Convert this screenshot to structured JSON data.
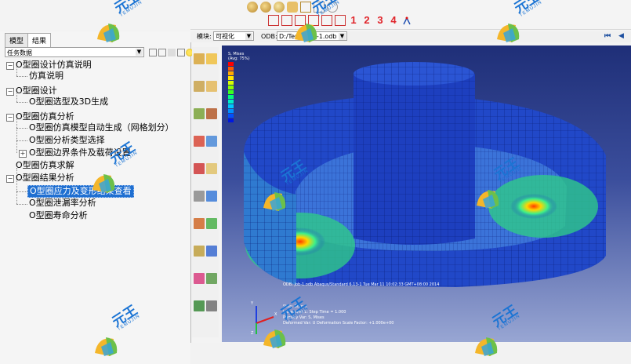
{
  "left_panel": {
    "tabs": [
      {
        "label": "模型",
        "active": false
      },
      {
        "label": "结果",
        "active": true
      }
    ],
    "task_select": {
      "value": "任务数据"
    },
    "tree": [
      {
        "label": "O型圈设计仿真说明",
        "level": 0,
        "expander": "minus"
      },
      {
        "label": "仿真说明",
        "level": 1
      },
      {
        "label": "O型圈设计",
        "level": 0,
        "expander": "minus"
      },
      {
        "label": "O型圈选型及3D生成",
        "level": 1
      },
      {
        "label": "O型圈仿真分析",
        "level": 0,
        "expander": "minus"
      },
      {
        "label": "O型圈仿真模型自动生成（网格划分）",
        "level": 1
      },
      {
        "label": "O型圈分析类型选择",
        "level": 1
      },
      {
        "label": "O型圈边界条件及载荷设置",
        "level": 1,
        "expander": "plus"
      },
      {
        "label": "O型圈仿真求解",
        "level": 0
      },
      {
        "label": "O型圈结果分析",
        "level": 0,
        "expander": "minus"
      },
      {
        "label": "O型圈应力及变形结果查看",
        "level": 1,
        "selected": true
      },
      {
        "label": "O型圈泄漏率分析",
        "level": 1
      },
      {
        "label": "O型圈寿命分析",
        "level": 1
      }
    ]
  },
  "toolbar": {
    "view_buttons": [
      "1",
      "2",
      "3",
      "4"
    ]
  },
  "module_bar": {
    "module_label": "模块:",
    "module_value": "可视化",
    "odb_label": "ODB:",
    "odb_value": "D:/Temp/Job-1.odb"
  },
  "tool_column": {
    "icons": [
      "field-output-icon",
      "deformed-shape-icon",
      "contour-icon",
      "symbol-plot-icon",
      "material-orientation-icon",
      "animate-icon",
      "xy-data-icon",
      "query-icon",
      "path-icon",
      "display-group-icon",
      "view-cut-icon",
      "common-options-icon",
      "superimpose-icon",
      "free-body-icon",
      "stream-icon",
      "translate-icon",
      "compare-icon",
      "report-icon",
      "options-icon",
      "select-icon"
    ]
  },
  "viewport": {
    "legend": {
      "title": "S, Mises",
      "subtitle": "(Avg: 75%)",
      "colors": [
        "#ff0000",
        "#ff5a00",
        "#ffaa00",
        "#ffe600",
        "#d8ff00",
        "#8cff00",
        "#3cff1e",
        "#00ff7a",
        "#00f0c8",
        "#00c8ff",
        "#0090ff",
        "#0050ff",
        "#0018e0"
      ]
    },
    "odb_caption": "ODB: Job-1.odb    Abaqus/Standard 6.13-1    Tue Mar 11 10:02:33 GMT+08:00 2014",
    "step_lines": [
      "Step: Step-1",
      "Increment 1: Step Time = 1.000",
      "Primary Var: S, Mises",
      "Deformed Var: U   Deformation Scale Factor: +1.000e+00"
    ],
    "triad_labels": {
      "x": "X",
      "y": "Y",
      "z": "Z"
    }
  },
  "watermark": {
    "text": "元王",
    "sub": "TEMUJIN"
  }
}
